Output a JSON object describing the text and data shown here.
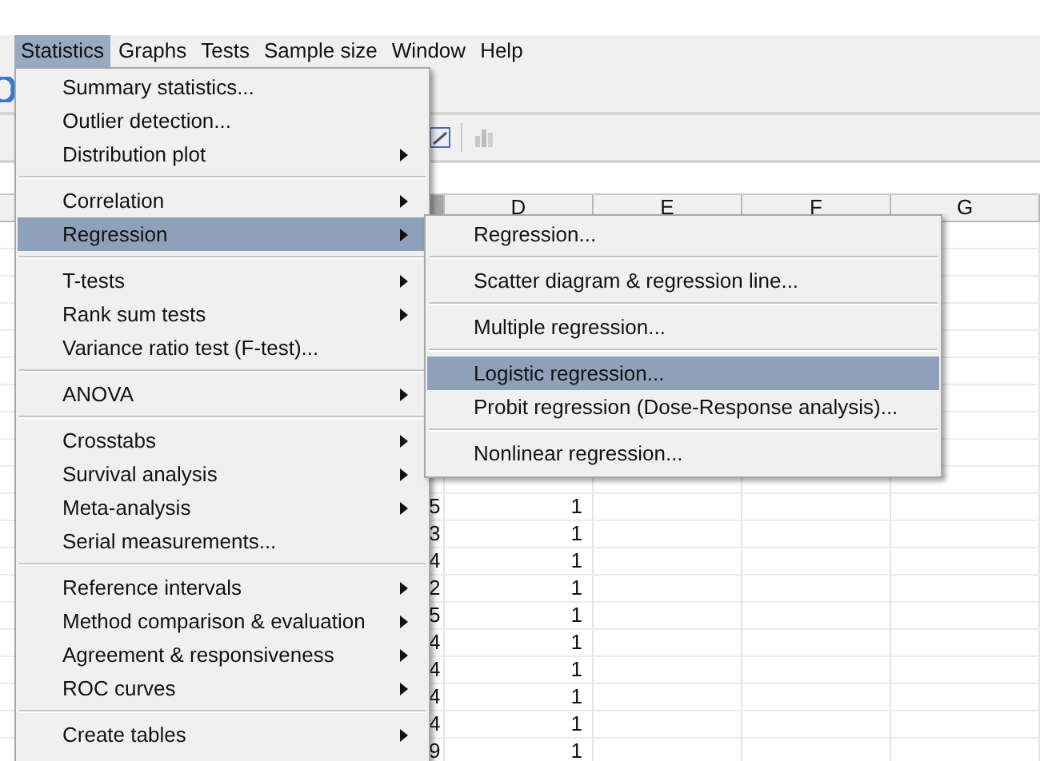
{
  "menubar": [
    {
      "label": "Statistics",
      "selected": true
    },
    {
      "label": "Graphs",
      "selected": false
    },
    {
      "label": "Tests",
      "selected": false
    },
    {
      "label": "Sample size",
      "selected": false
    },
    {
      "label": "Window",
      "selected": false
    },
    {
      "label": "Help",
      "selected": false
    }
  ],
  "statistics_menu": [
    [
      {
        "label": "Summary statistics...",
        "submenu": false,
        "selected": false
      },
      {
        "label": "Outlier detection...",
        "submenu": false,
        "selected": false
      },
      {
        "label": "Distribution plot",
        "submenu": true,
        "selected": false
      }
    ],
    [
      {
        "label": "Correlation",
        "submenu": true,
        "selected": false
      },
      {
        "label": "Regression",
        "submenu": true,
        "selected": true
      }
    ],
    [
      {
        "label": "T-tests",
        "submenu": true,
        "selected": false
      },
      {
        "label": "Rank sum tests",
        "submenu": true,
        "selected": false
      },
      {
        "label": "Variance ratio test (F-test)...",
        "submenu": false,
        "selected": false
      }
    ],
    [
      {
        "label": "ANOVA",
        "submenu": true,
        "selected": false
      }
    ],
    [
      {
        "label": "Crosstabs",
        "submenu": true,
        "selected": false
      },
      {
        "label": "Survival analysis",
        "submenu": true,
        "selected": false
      },
      {
        "label": "Meta-analysis",
        "submenu": true,
        "selected": false
      },
      {
        "label": "Serial measurements...",
        "submenu": false,
        "selected": false
      }
    ],
    [
      {
        "label": "Reference intervals",
        "submenu": true,
        "selected": false
      },
      {
        "label": "Method comparison & evaluation",
        "submenu": true,
        "selected": false
      },
      {
        "label": "Agreement & responsiveness",
        "submenu": true,
        "selected": false
      },
      {
        "label": "ROC curves",
        "submenu": true,
        "selected": false
      }
    ],
    [
      {
        "label": "Create tables",
        "submenu": true,
        "selected": false
      }
    ]
  ],
  "regression_submenu": [
    [
      {
        "label": "Regression...",
        "selected": false
      }
    ],
    [
      {
        "label": "Scatter diagram & regression line...",
        "selected": false
      }
    ],
    [
      {
        "label": "Multiple regression...",
        "selected": false
      }
    ],
    [
      {
        "label": "Logistic regression...",
        "selected": true
      },
      {
        "label": "Probit regression (Dose-Response analysis)...",
        "selected": false
      }
    ],
    [
      {
        "label": "Nonlinear regression...",
        "selected": false
      }
    ]
  ],
  "spreadsheet": {
    "columns": [
      "D",
      "E",
      "F",
      "G"
    ],
    "rows": [
      {
        "column_c": "5",
        "column_d": "1"
      },
      {
        "column_c": "3",
        "column_d": "1"
      },
      {
        "column_c": "4",
        "column_d": "1"
      },
      {
        "column_c": "2",
        "column_d": "1"
      },
      {
        "column_c": "5",
        "column_d": "1"
      },
      {
        "column_c": "4",
        "column_d": "1"
      },
      {
        "column_c": "4",
        "column_d": "1"
      },
      {
        "column_c": "4",
        "column_d": "1"
      },
      {
        "column_c": "4",
        "column_d": "1"
      },
      {
        "column_c": "9",
        "column_d": "1"
      }
    ]
  }
}
